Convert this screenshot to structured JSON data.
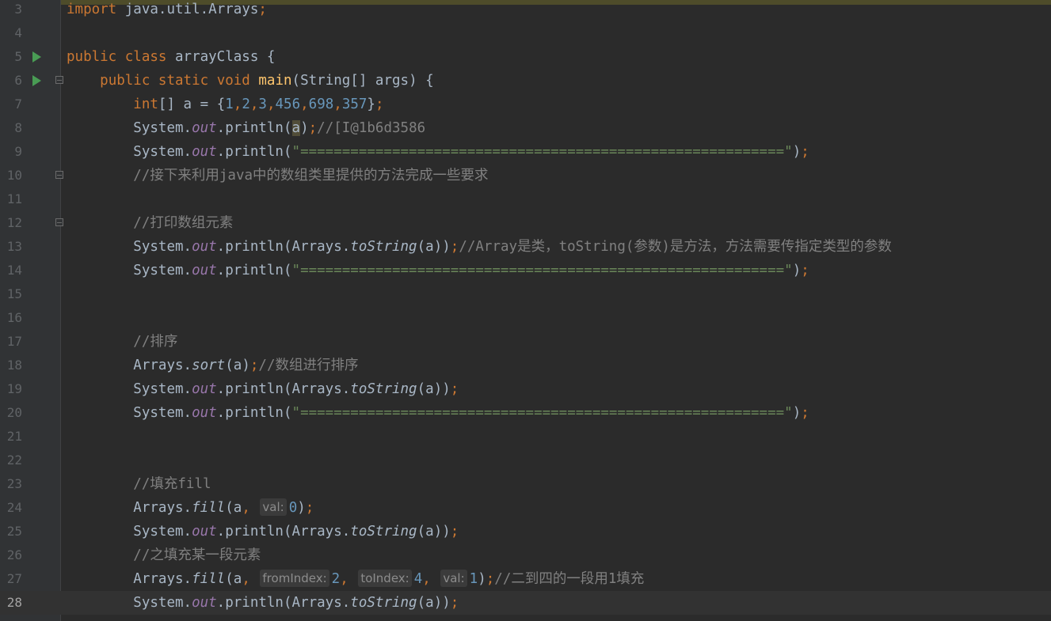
{
  "editor": {
    "lines": [
      {
        "n": "3",
        "text": "import java.util.Arrays;"
      },
      {
        "n": "4",
        "text": ""
      },
      {
        "n": "5",
        "text": "public class arrayClass {"
      },
      {
        "n": "6",
        "text": "    public static void main(String[] args) {"
      },
      {
        "n": "7",
        "text": "        int[] a = {1,2,3,456,698,357};"
      },
      {
        "n": "8",
        "text": "        System.out.println(a);//[I@1b6d3586"
      },
      {
        "n": "9",
        "text": "        System.out.println(\"==========================================================\");"
      },
      {
        "n": "10",
        "text": "        //接下来利用java中的数组类里提供的方法完成一些要求"
      },
      {
        "n": "11",
        "text": ""
      },
      {
        "n": "12",
        "text": "        //打印数组元素"
      },
      {
        "n": "13",
        "text": "        System.out.println(Arrays.toString(a));//Array是类，toString(参数)是方法，方法需要传指定类型的参数"
      },
      {
        "n": "14",
        "text": "        System.out.println(\"==========================================================\");"
      },
      {
        "n": "15",
        "text": ""
      },
      {
        "n": "16",
        "text": ""
      },
      {
        "n": "17",
        "text": "        //排序"
      },
      {
        "n": "18",
        "text": "        Arrays.sort(a);//数组进行排序"
      },
      {
        "n": "19",
        "text": "        System.out.println(Arrays.toString(a));"
      },
      {
        "n": "20",
        "text": "        System.out.println(\"==========================================================\");"
      },
      {
        "n": "21",
        "text": ""
      },
      {
        "n": "22",
        "text": ""
      },
      {
        "n": "23",
        "text": "        //填充fill"
      },
      {
        "n": "24",
        "text": "        Arrays.fill(a, val: 0);"
      },
      {
        "n": "25",
        "text": "        System.out.println(Arrays.toString(a));"
      },
      {
        "n": "26",
        "text": "        //之填充某一段元素"
      },
      {
        "n": "27",
        "text": "        Arrays.fill(a, fromIndex: 2, toIndex: 4, val: 1);//二到四的一段用1填充"
      },
      {
        "n": "28",
        "text": "        System.out.println(Arrays.toString(a));"
      }
    ],
    "current_line": "28",
    "run_gutter_lines": [
      "5",
      "6"
    ],
    "fold_lines": [
      "6",
      "10",
      "12"
    ],
    "colors": {
      "keyword": "#cc7832",
      "string": "#6a8759",
      "number": "#6897bb",
      "comment": "#808080",
      "field": "#9876aa",
      "method": "#ffc66d",
      "text": "#a9b7c6",
      "background": "#2b2b2b"
    }
  }
}
